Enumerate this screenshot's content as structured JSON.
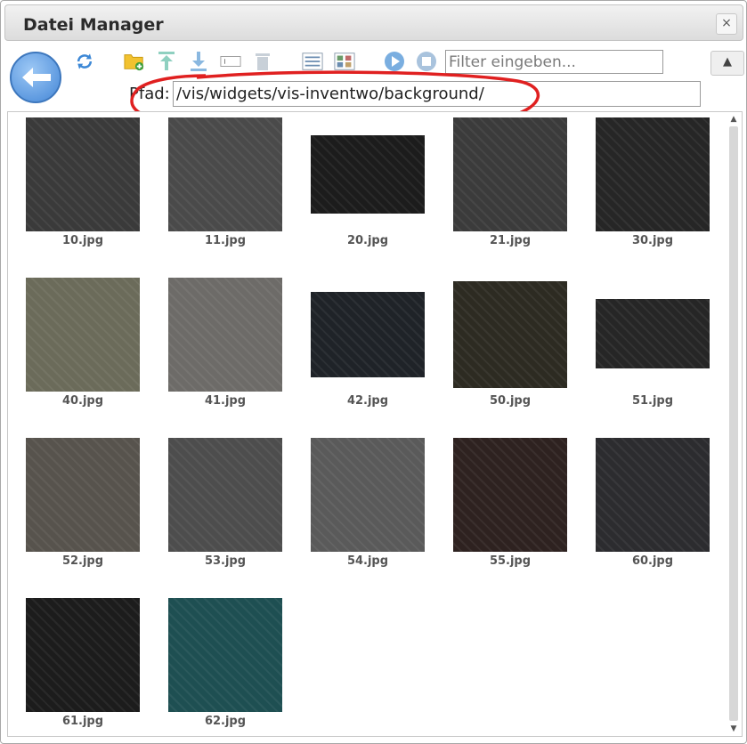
{
  "window": {
    "title": "Datei Manager",
    "close_symbol": "×"
  },
  "toolbar": {
    "filter_placeholder": "Filter eingeben...",
    "path_label": "Pfad:",
    "path_value": "/vis/widgets/vis-inventwo/background/",
    "warn_symbol": "▲"
  },
  "files": [
    {
      "name": "10.jpg",
      "color": "#3a3a3a"
    },
    {
      "name": "11.jpg",
      "color": "#4a4a4a"
    },
    {
      "name": "20.jpg",
      "color": "#1c1c1c"
    },
    {
      "name": "21.jpg",
      "color": "#3b3b3b"
    },
    {
      "name": "30.jpg",
      "color": "#262626"
    },
    {
      "name": "40.jpg",
      "color": "#6b6b5a"
    },
    {
      "name": "41.jpg",
      "color": "#6d6b68"
    },
    {
      "name": "42.jpg",
      "color": "#1f2328"
    },
    {
      "name": "50.jpg",
      "color": "#2d2b22"
    },
    {
      "name": "51.jpg",
      "color": "#262626"
    },
    {
      "name": "52.jpg",
      "color": "#57534d"
    },
    {
      "name": "53.jpg",
      "color": "#4d4d4d"
    },
    {
      "name": "54.jpg",
      "color": "#5a5a5a"
    },
    {
      "name": "55.jpg",
      "color": "#2e2220"
    },
    {
      "name": "60.jpg",
      "color": "#2c2c2f"
    },
    {
      "name": "61.jpg",
      "color": "#1c1c1c"
    },
    {
      "name": "62.jpg",
      "color": "#1e4f52"
    }
  ]
}
